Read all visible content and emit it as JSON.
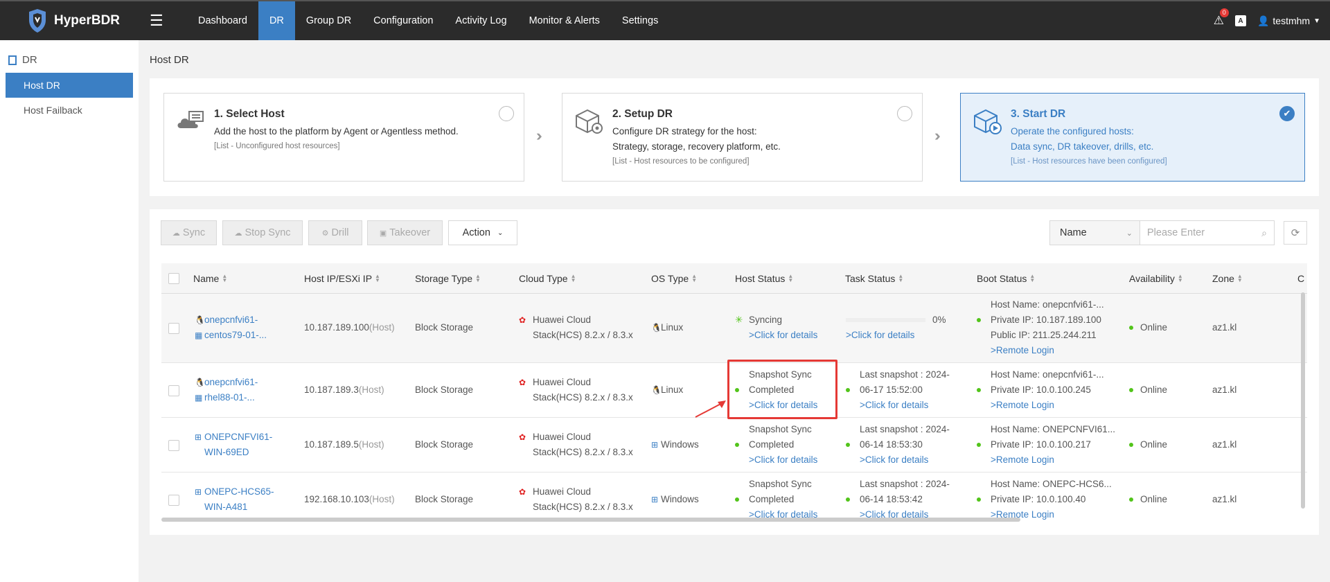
{
  "app": {
    "name": "HyperBDR"
  },
  "nav": {
    "items": [
      "Dashboard",
      "DR",
      "Group DR",
      "Configuration",
      "Activity Log",
      "Monitor & Alerts",
      "Settings"
    ],
    "active": "DR"
  },
  "header_right": {
    "alert_count": "0",
    "font_icon": "A",
    "username": "testmhm"
  },
  "sidebar": {
    "section": "DR",
    "items": [
      {
        "label": "Host DR",
        "active": true
      },
      {
        "label": "Host Failback",
        "active": false
      }
    ]
  },
  "page": {
    "title": "Host DR"
  },
  "steps": [
    {
      "title": "1. Select Host",
      "desc": "Add the host to the platform by Agent or Agentless method.",
      "note": "[List - Unconfigured host resources]",
      "checked": false
    },
    {
      "title": "2. Setup DR",
      "desc": "Configure DR strategy for the host:\nStrategy, storage, recovery platform, etc.",
      "note": "[List - Host resources to be configured]",
      "checked": false
    },
    {
      "title": "3. Start DR",
      "desc": "Operate the configured hosts:\nData sync, DR takeover, drills, etc.",
      "note": "[List - Host resources have been configured]",
      "checked": true
    }
  ],
  "toolbar": {
    "buttons": [
      "Sync",
      "Stop Sync",
      "Drill",
      "Takeover"
    ],
    "action_label": "Action",
    "search_field": "Name",
    "search_placeholder": "Please Enter"
  },
  "table": {
    "columns": [
      "Name",
      "Host IP/ESXi IP",
      "Storage Type",
      "Cloud Type",
      "OS Type",
      "Host Status",
      "Task Status",
      "Boot Status",
      "Availability",
      "Zone",
      "C"
    ],
    "rows": [
      {
        "name": [
          "onepcnfvi61-",
          "centos79-01-..."
        ],
        "ip": "10.187.189.100",
        "ip_suffix": "(Host)",
        "storage": "Block Storage",
        "cloud": [
          "Huawei Cloud",
          "Stack(HCS) 8.2.x / 8.3.x"
        ],
        "os": "Linux",
        "host_status": [
          "Syncing"
        ],
        "host_status_link": ">Click for details",
        "task_status": [
          "0%"
        ],
        "task_progress": 0,
        "task_link": ">Click for details",
        "boot": [
          "Host Name: onepcnfvi61-...",
          "Private IP: 10.187.189.100",
          "Public IP: 211.25.244.211"
        ],
        "boot_link": ">Remote Login",
        "availability": "Online",
        "zone": "az1.kl"
      },
      {
        "name": [
          "onepcnfvi61-",
          "rhel88-01-..."
        ],
        "ip": "10.187.189.3",
        "ip_suffix": "(Host)",
        "storage": "Block Storage",
        "cloud": [
          "Huawei Cloud",
          "Stack(HCS) 8.2.x / 8.3.x"
        ],
        "os": "Linux",
        "host_status": [
          "Snapshot Sync",
          "Completed"
        ],
        "host_status_link": ">Click for details",
        "task_status": [
          "Last snapshot : 2024-",
          "06-17 15:52:00"
        ],
        "task_link": ">Click for details",
        "boot": [
          "Host Name: onepcnfvi61-...",
          "Private IP: 10.0.100.245"
        ],
        "boot_link": ">Remote Login",
        "availability": "Online",
        "zone": "az1.kl"
      },
      {
        "name": [
          "ONEPCNFVI61-",
          "WIN-69ED"
        ],
        "ip": "10.187.189.5",
        "ip_suffix": "(Host)",
        "storage": "Block Storage",
        "cloud": [
          "Huawei Cloud",
          "Stack(HCS) 8.2.x / 8.3.x"
        ],
        "os": "Windows",
        "host_status": [
          "Snapshot Sync",
          "Completed"
        ],
        "host_status_link": ">Click for details",
        "task_status": [
          "Last snapshot : 2024-",
          "06-14 18:53:30"
        ],
        "task_link": ">Click for details",
        "boot": [
          "Host Name: ONEPCNFVI61...",
          "Private IP: 10.0.100.217"
        ],
        "boot_link": ">Remote Login",
        "availability": "Online",
        "zone": "az1.kl"
      },
      {
        "name": [
          "ONEPC-HCS65-",
          "WIN-A481"
        ],
        "ip": "192.168.10.103",
        "ip_suffix": "(Host)",
        "storage": "Block Storage",
        "cloud": [
          "Huawei Cloud",
          "Stack(HCS) 8.2.x / 8.3.x"
        ],
        "os": "Windows",
        "host_status": [
          "Snapshot Sync",
          "Completed"
        ],
        "host_status_link": ">Click for details",
        "task_status": [
          "Last snapshot : 2024-",
          "06-14 18:53:42"
        ],
        "task_link": ">Click for details",
        "boot": [
          "Host Name: ONEPC-HCS6...",
          "Private IP: 10.0.100.40"
        ],
        "boot_link": ">Remote Login",
        "availability": "Online",
        "zone": "az1.kl"
      }
    ]
  },
  "colors": {
    "accent": "#3b7fc4",
    "topbar": "#2b2b2b",
    "online": "#52c41a",
    "highlight": "#e53935"
  }
}
